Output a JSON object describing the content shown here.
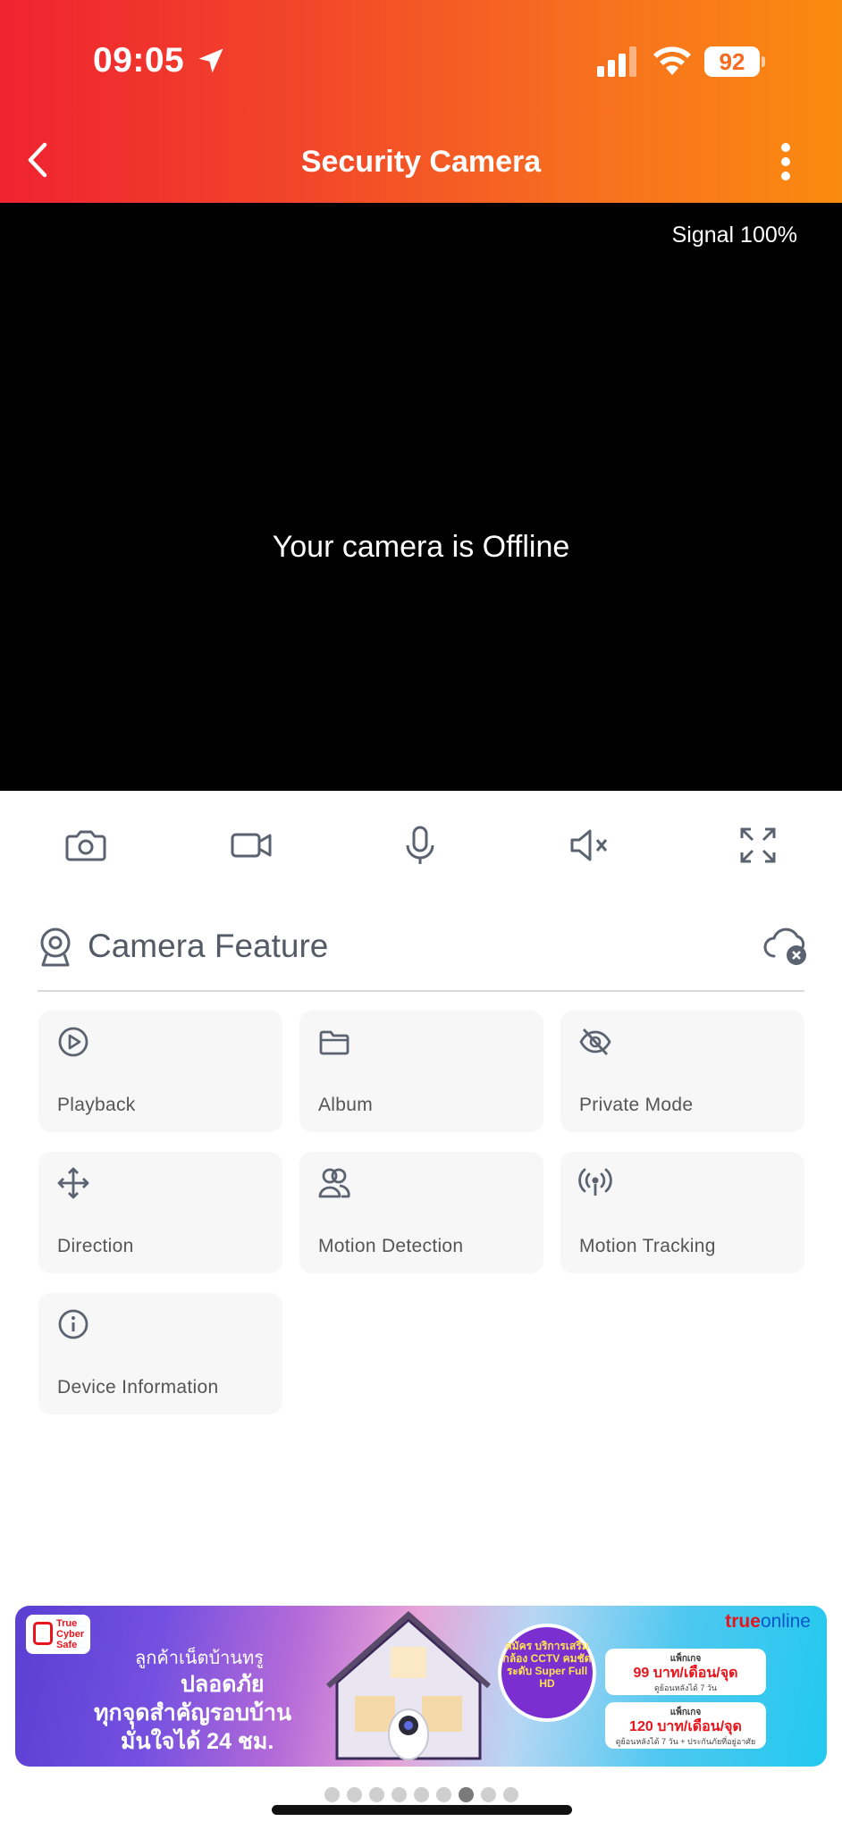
{
  "status_bar": {
    "time": "09:05",
    "battery": "92",
    "icons": [
      "location-arrow-icon",
      "cellular-signal-icon",
      "wifi-icon",
      "battery-icon"
    ]
  },
  "nav": {
    "title": "Security Camera",
    "back_icon": "chevron-left-icon",
    "more_icon": "more-vertical-icon"
  },
  "video": {
    "signal": "Signal 100%",
    "message": "Your camera is Offline"
  },
  "controls": [
    {
      "icon": "camera-icon"
    },
    {
      "icon": "video-record-icon"
    },
    {
      "icon": "microphone-icon"
    },
    {
      "icon": "speaker-muted-icon"
    },
    {
      "icon": "fullscreen-icon"
    }
  ],
  "feature": {
    "title": "Camera Feature",
    "cloud_icon": "cloud-error-icon",
    "items": [
      {
        "label": "Playback",
        "icon": "play-circle-icon"
      },
      {
        "label": "Album",
        "icon": "folder-icon"
      },
      {
        "label": "Private Mode",
        "icon": "eye-off-icon"
      },
      {
        "label": "Direction",
        "icon": "move-arrows-icon"
      },
      {
        "label": "Motion Detection",
        "icon": "people-icon"
      },
      {
        "label": "Motion Tracking",
        "icon": "tracking-waves-icon"
      },
      {
        "label": "Device Information",
        "icon": "info-circle-icon"
      }
    ]
  },
  "banner": {
    "logo_text": "True Cyber Safe",
    "line1": "ลูกค้าเน็ตบ้านทรู",
    "line2": "ปลอดภัย",
    "line3": "ทุกจุดสำคัญรอบบ้าน",
    "line4": "มั่นใจได้ 24 ชม.",
    "circle_text": "สมัคร บริการเสริม กล้อง CCTV คมชัดระดับ Super Full HD",
    "brand_main": "true",
    "brand_sub": "online",
    "pkg1_head": "แพ็กเกจ",
    "pkg1_price": "99 บาท/เดือน/จุด",
    "pkg1_note": "ดูย้อนหลังได้ 7 วัน",
    "pkg2_head": "แพ็กเกจ",
    "pkg2_price": "120 บาท/เดือน/จุด",
    "pkg2_note": "ดูย้อนหลังได้ 7 วัน + ประกันภัยที่อยู่อาศัย"
  },
  "pager": {
    "count": 9,
    "active_index": 6
  }
}
